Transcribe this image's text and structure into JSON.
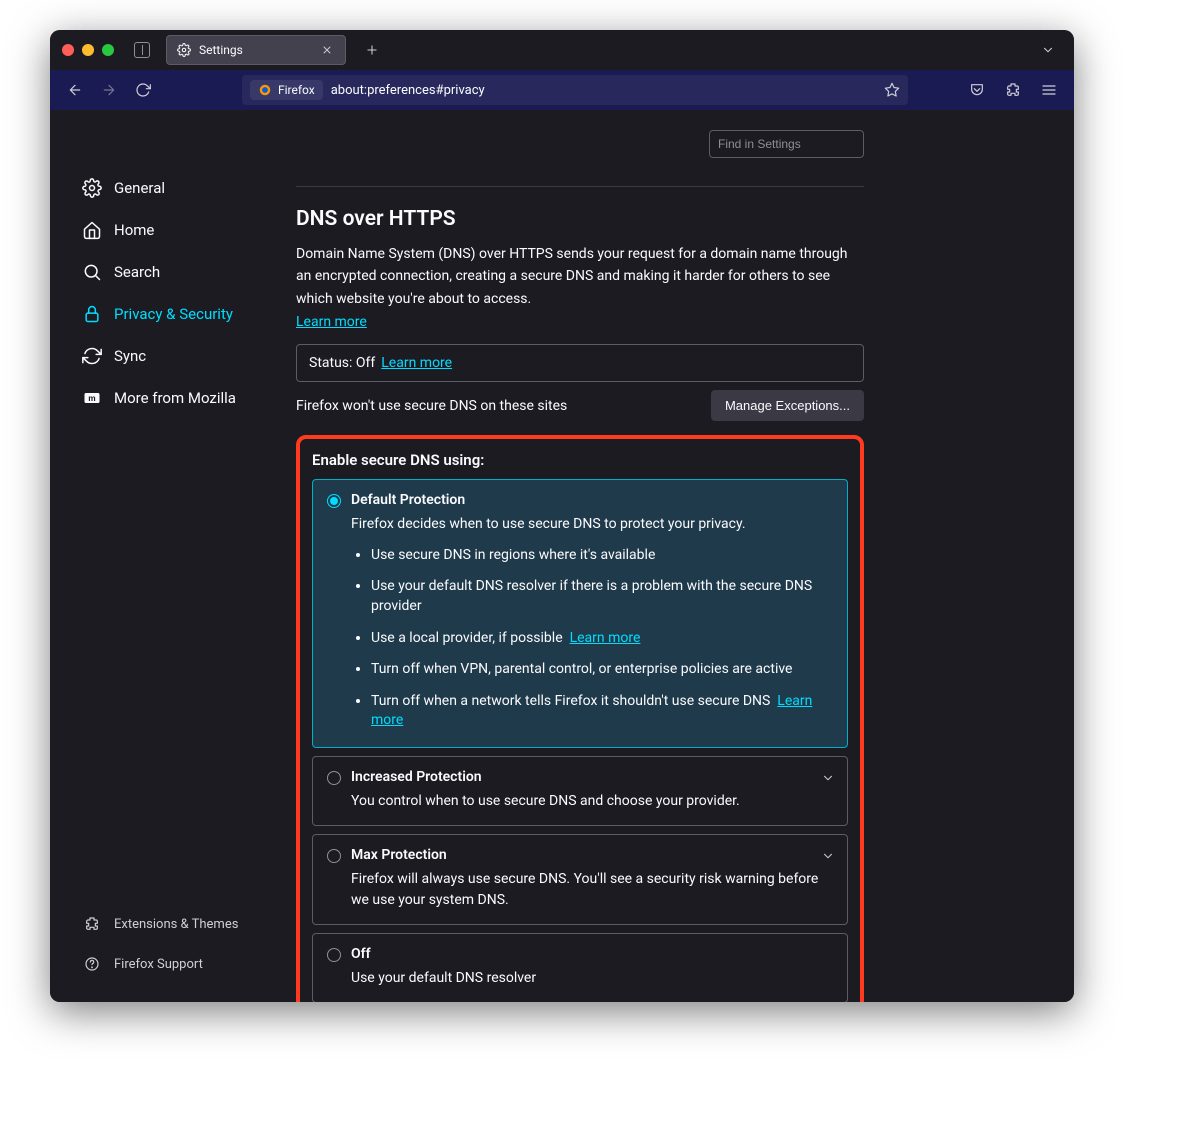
{
  "tab": {
    "title": "Settings"
  },
  "url": {
    "identity": "Firefox",
    "address": "about:preferences#privacy"
  },
  "search": {
    "placeholder": "Find in Settings"
  },
  "sidebar": {
    "items": [
      {
        "label": "General"
      },
      {
        "label": "Home"
      },
      {
        "label": "Search"
      },
      {
        "label": "Privacy & Security"
      },
      {
        "label": "Sync"
      },
      {
        "label": "More from Mozilla"
      }
    ],
    "bottom": [
      {
        "label": "Extensions & Themes"
      },
      {
        "label": "Firefox Support"
      }
    ]
  },
  "main": {
    "title": "DNS over HTTPS",
    "desc": "Domain Name System (DNS) over HTTPS sends your request for a domain name through an encrypted connection, creating a secure DNS and making it harder for others to see which website you're about to access.",
    "learn": "Learn more",
    "status_label": "Status: Off",
    "status_learn": "Learn more",
    "exceptions_text": "Firefox won't use secure DNS on these sites",
    "exceptions_btn": "Manage Exceptions...",
    "enable_heading": "Enable secure DNS using:",
    "options": [
      {
        "title": "Default Protection",
        "sub": "Firefox decides when to use secure DNS to protect your privacy.",
        "bullets": [
          "Use secure DNS in regions where it's available",
          "Use your default DNS resolver if there is a problem with the secure DNS provider",
          "Use a local provider, if possible",
          "Turn off when VPN, parental control, or enterprise policies are active",
          "Turn off when a network tells Firefox it shouldn't use secure DNS"
        ],
        "bullet_learn_2": "Learn more",
        "bullet_learn_4": "Learn more"
      },
      {
        "title": "Increased Protection",
        "sub": "You control when to use secure DNS and choose your provider."
      },
      {
        "title": "Max Protection",
        "sub": "Firefox will always use secure DNS. You'll see a security risk warning before we use your system DNS."
      },
      {
        "title": "Off",
        "sub": "Use your default DNS resolver"
      }
    ]
  }
}
